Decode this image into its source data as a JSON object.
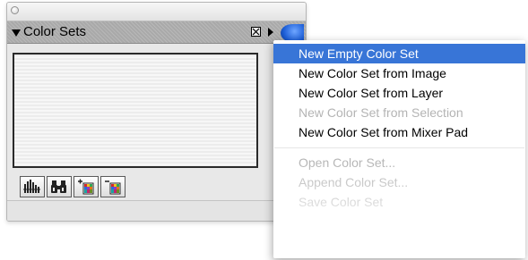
{
  "palette": {
    "title": "Color Sets",
    "toolbar": [
      {
        "icon": "color-bars-icon"
      },
      {
        "icon": "binoculars-icon"
      },
      {
        "icon": "add-swatch-icon"
      },
      {
        "icon": "remove-swatch-icon"
      }
    ]
  },
  "menu": {
    "items": [
      {
        "label": "New Empty Color Set",
        "state": "highlighted"
      },
      {
        "label": "New Color Set from Image",
        "state": "enabled"
      },
      {
        "label": "New Color Set from Layer",
        "state": "enabled"
      },
      {
        "label": "New Color Set from Selection",
        "state": "disabled"
      },
      {
        "label": "New Color Set from Mixer Pad",
        "state": "enabled"
      },
      {
        "label": "Open Color Set...",
        "state": "disabled"
      },
      {
        "label": "Append Color Set...",
        "state": "disabled"
      },
      {
        "label": "Save Color Set",
        "state": "disabled"
      }
    ]
  },
  "colors": {
    "highlight": "#3875d7",
    "disabled_text": "#b4b4b4",
    "menu_button": "#1d5fd8"
  }
}
